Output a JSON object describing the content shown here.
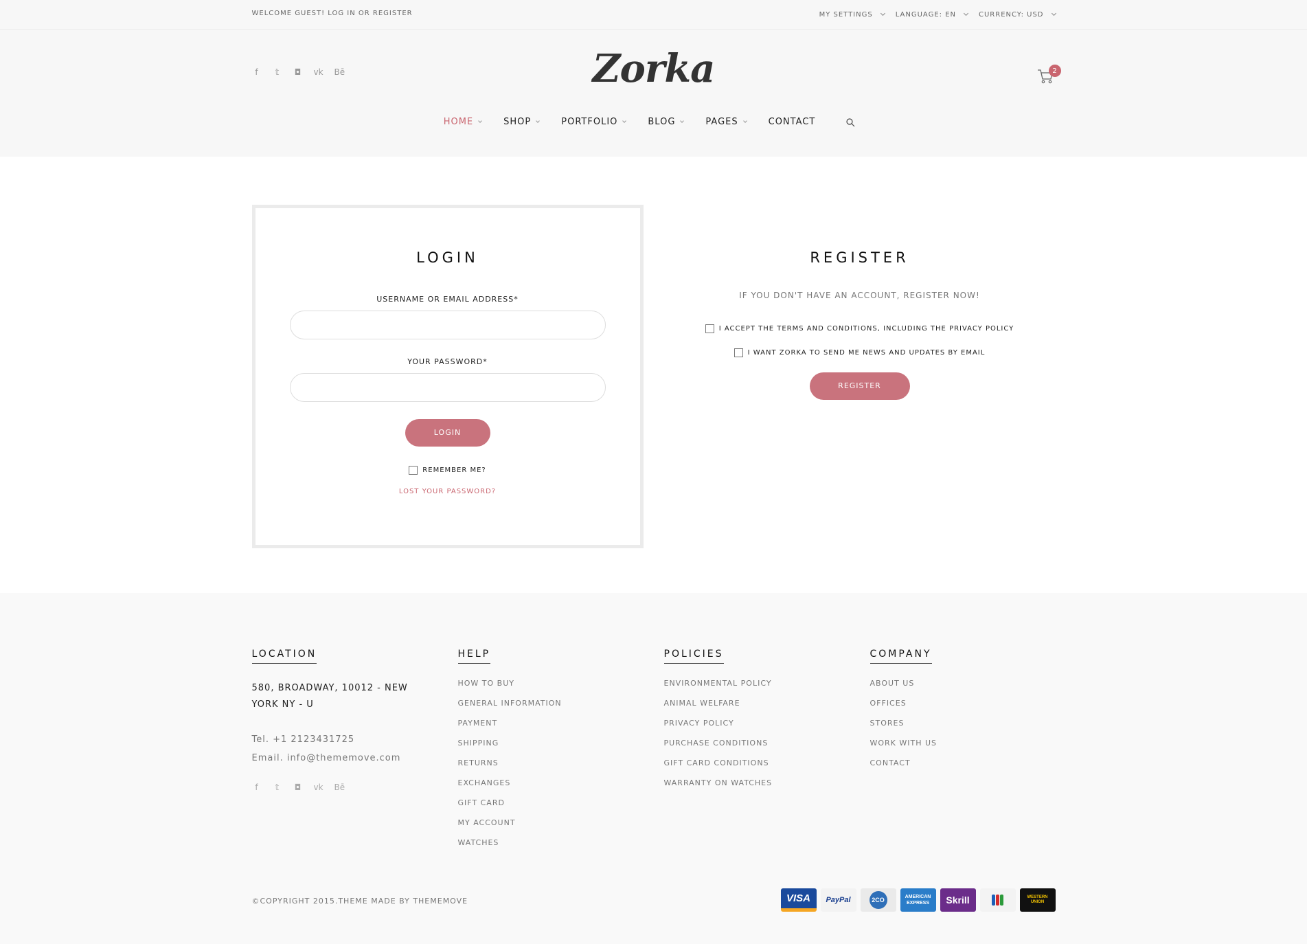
{
  "topbar": {
    "welcome": "WELCOME GUEST! LOG IN OR REGISTER",
    "my_settings": "MY SETTINGS",
    "language": "LANGUAGE: EN",
    "currency": "CURRENCY: USD"
  },
  "header": {
    "logo": "Zorka",
    "cart_count": "2",
    "social_icons": [
      "facebook-icon",
      "twitter-icon",
      "instagram-icon",
      "vk-icon",
      "behance-icon"
    ]
  },
  "nav": {
    "home": "HOME",
    "shop": "SHOP",
    "portfolio": "PORTFOLIO",
    "blog": "BLOG",
    "pages": "PAGES",
    "contact": "CONTACT"
  },
  "login": {
    "title": "LOGIN",
    "username_label": "USERNAME OR EMAIL ADDRESS*",
    "password_label": "YOUR PASSWORD*",
    "button": "LOGIN",
    "remember": "REMEMBER ME?",
    "lost_password": "LOST YOUR PASSWORD?"
  },
  "register": {
    "title": "REGISTER",
    "description": "IF YOU DON'T HAVE AN ACCOUNT, REGISTER NOW!",
    "accept_terms": "I ACCEPT THE TERMS AND CONDITIONS, INCLUDING THE PRIVACY POLICY",
    "newsletter": "I WANT ZORKA TO SEND ME NEWS AND UPDATES BY EMAIL",
    "button": "REGISTER"
  },
  "footer": {
    "location": {
      "title": "LOCATION",
      "address": "580, BROADWAY, 10012 - NEW YORK NY - U",
      "tel": "Tel. +1 2123431725",
      "email": "Email. info@thememove.com"
    },
    "help": {
      "title": "HELP",
      "links": [
        "HOW TO BUY",
        "GENERAL INFORMATION",
        "PAYMENT",
        "SHIPPING",
        "RETURNS",
        "EXCHANGES",
        "GIFT CARD",
        "MY ACCOUNT",
        "WATCHES"
      ]
    },
    "policies": {
      "title": "POLICIES",
      "links": [
        "ENVIRONMENTAL POLICY",
        "ANIMAL WELFARE",
        "PRIVACY POLICY",
        "PURCHASE CONDITIONS",
        "GIFT CARD CONDITIONS",
        "WARRANTY ON WATCHES"
      ]
    },
    "company": {
      "title": "COMPANY",
      "links": [
        "ABOUT US",
        "OFFICES",
        "STORES",
        "WORK WITH US",
        "CONTACT"
      ]
    },
    "copyright": "©COPYRIGHT 2015.THEME MADE BY THEMEMOVE",
    "payments": {
      "visa": "VISA",
      "paypal": "PayPal",
      "twoco": "2CO",
      "amex": "AMERICAN EXPRESS",
      "skrill": "Skrill",
      "jcb": "JCB",
      "western_union": "WESTERN UNION"
    }
  },
  "colors": {
    "accent": "#c9656f",
    "button": "#c9737d",
    "header_bg": "#f7f7f7",
    "footer_bg": "#f9f9f9"
  }
}
